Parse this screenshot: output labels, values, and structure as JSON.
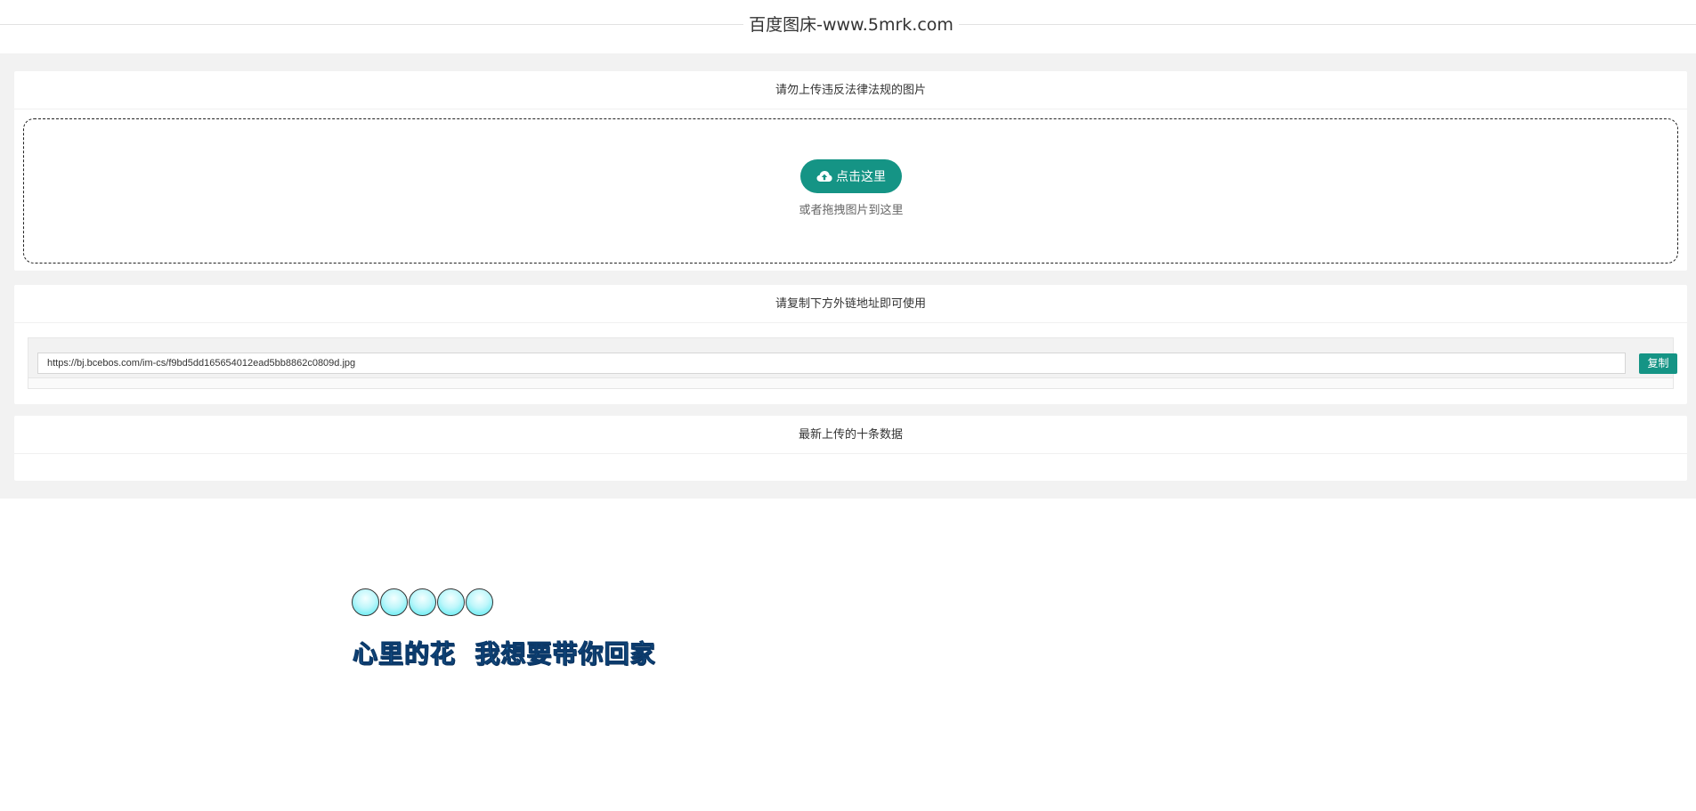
{
  "header": {
    "title": "百度图床-www.5mrk.com"
  },
  "upload": {
    "notice": "请勿上传违反法律法规的图片",
    "button_label": "点击这里",
    "drop_hint": "或者拖拽图片到这里",
    "button_icon": "cloud-upload-icon"
  },
  "link": {
    "heading": "请复制下方外链地址即可使用",
    "url": "https://bj.bcebos.com/im-cs/f9bd5dd165654012ead5bb8862c0809d.jpg",
    "copy_label": "复制"
  },
  "recent": {
    "heading": "最新上传的十条数据"
  },
  "decoration": {
    "slogan": "心里的花  我想要带你回家",
    "bubble_count": 5
  },
  "colors": {
    "accent": "#159485",
    "band": "#f2f2f2",
    "slogan": "#2a82c8"
  }
}
